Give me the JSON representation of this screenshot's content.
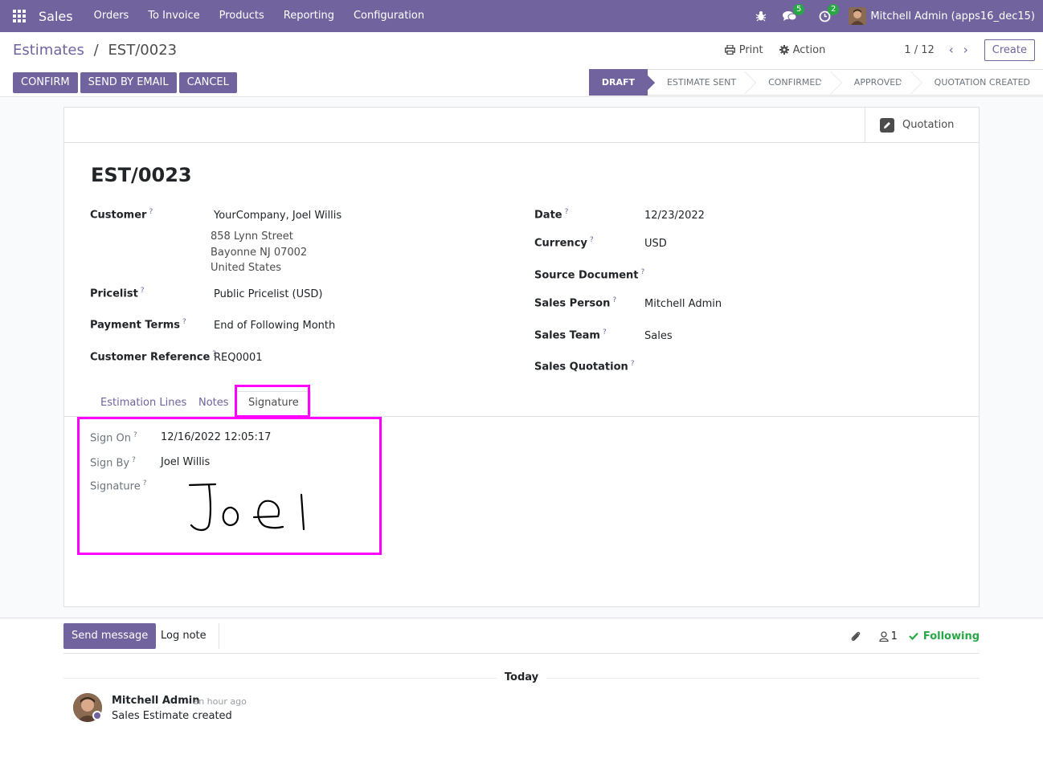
{
  "navbar": {
    "app_name": "Sales",
    "menu": [
      "Orders",
      "To Invoice",
      "Products",
      "Reporting",
      "Configuration"
    ],
    "messages_count": "5",
    "activities_count": "2",
    "user": "Mitchell Admin (apps16_dec15)"
  },
  "breadcrumb": {
    "parent": "Estimates",
    "separator": "/",
    "current": "EST/0023"
  },
  "actions": {
    "print": "Print",
    "action": "Action",
    "pager": "1 / 12",
    "create": "Create"
  },
  "header_buttons": {
    "confirm": "CONFIRM",
    "send_by_email": "SEND BY EMAIL",
    "cancel": "CANCEL"
  },
  "status_steps": [
    "DRAFT",
    "ESTIMATE SENT",
    "CONFIRMED",
    "APPROVED",
    "QUOTATION CREATED"
  ],
  "smart_button": {
    "label": "Quotation"
  },
  "record": {
    "title": "EST/0023",
    "left_fields": {
      "customer_label": "Customer",
      "customer": "YourCompany, Joel Willis",
      "address": [
        "858 Lynn Street",
        "Bayonne NJ 07002",
        "United States"
      ],
      "pricelist_label": "Pricelist",
      "pricelist": "Public Pricelist (USD)",
      "payment_terms_label": "Payment Terms",
      "payment_terms": "End of Following Month",
      "customer_reference_label": "Customer Reference",
      "customer_reference": "REQ0001"
    },
    "right_fields": {
      "date_label": "Date",
      "date": "12/23/2022",
      "currency_label": "Currency",
      "currency": "USD",
      "source_document_label": "Source Document",
      "source_document": "",
      "sales_person_label": "Sales Person",
      "sales_person": "Mitchell Admin",
      "sales_team_label": "Sales Team",
      "sales_team": "Sales",
      "sales_quotation_label": "Sales Quotation",
      "sales_quotation": ""
    },
    "help_marker": "?"
  },
  "tabs": [
    "Estimation Lines",
    "Notes",
    "Signature"
  ],
  "signature_tab": {
    "sign_on_label": "Sign On",
    "sign_on": "12/16/2022 12:05:17",
    "sign_by_label": "Sign By",
    "sign_by": "Joel Willis",
    "signature_label": "Signature",
    "signature_text": "Joel"
  },
  "chatter": {
    "send_message": "Send message",
    "log_note": "Log note",
    "followers_count": "1",
    "following": "Following",
    "separator": "Today",
    "message": {
      "author": "Mitchell Admin",
      "date": "- an hour ago",
      "body": "Sales Estimate created"
    }
  },
  "colors": {
    "brand": "#71639e",
    "highlight": "#ff00ff",
    "success": "#28a745"
  }
}
